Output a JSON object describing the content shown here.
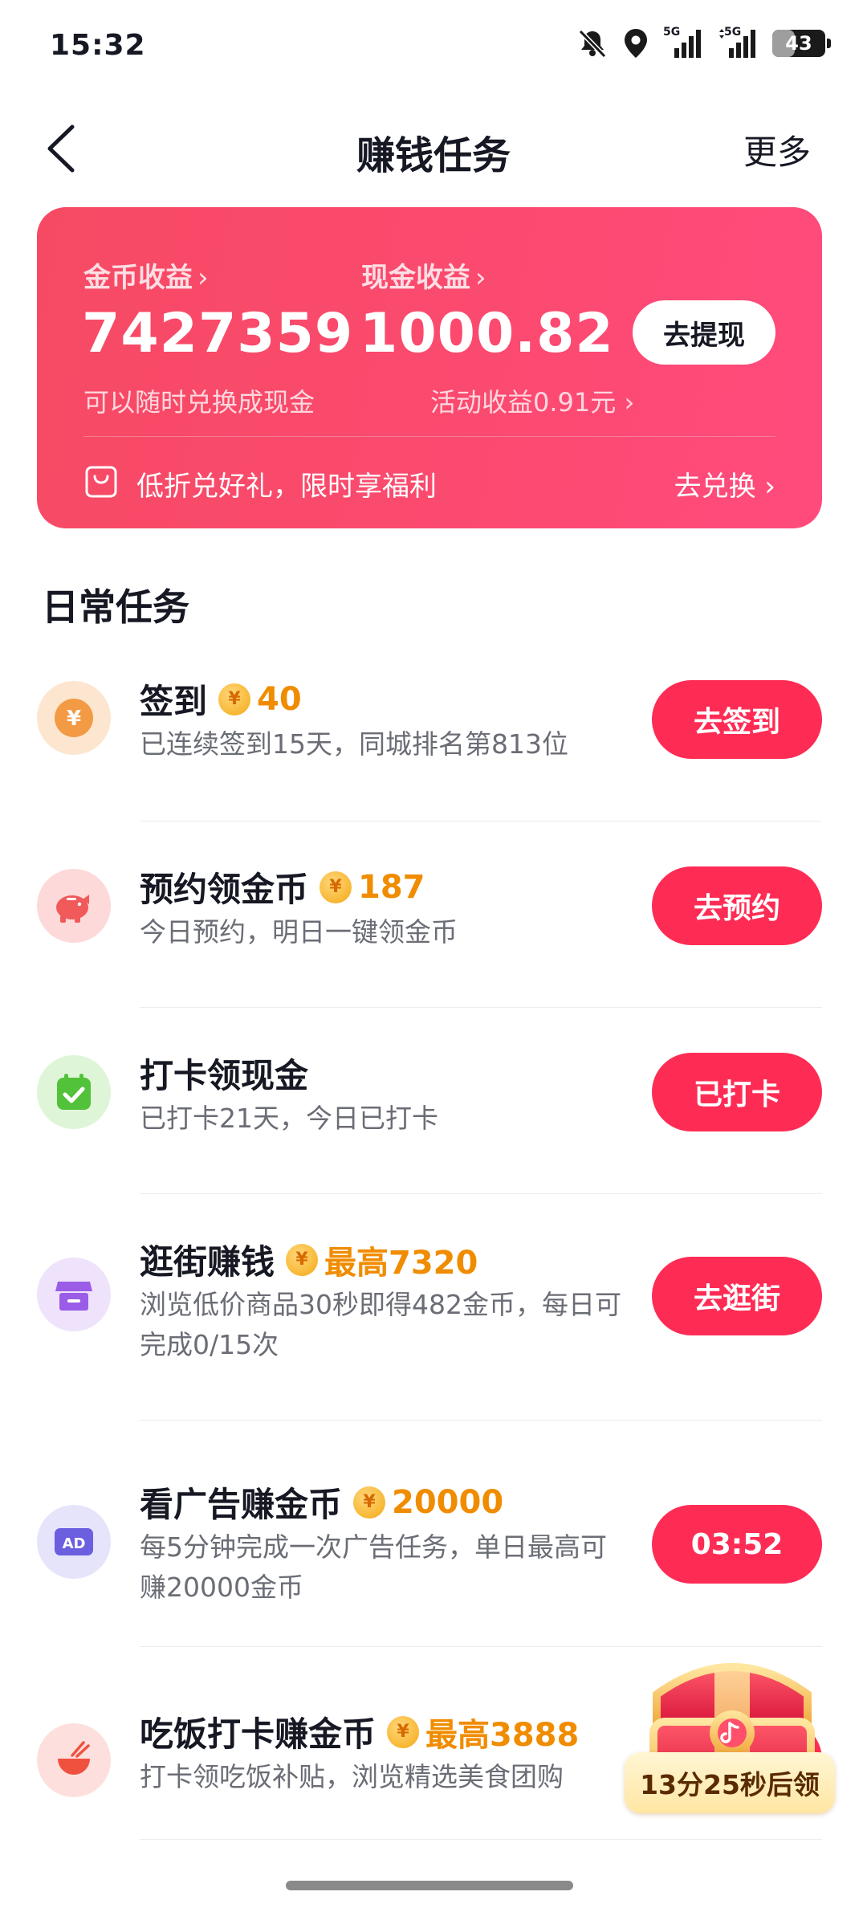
{
  "status_bar": {
    "time": "15:32",
    "signal1_label": "5G",
    "signal2_label": "5G",
    "battery": "43",
    "battery_level": 0.43
  },
  "header": {
    "title": "赚钱任务",
    "more": "更多"
  },
  "earnings": {
    "coin_label": "金币收益",
    "coin_value": "7427359",
    "coin_sub": "可以随时兑换成现金",
    "cash_label": "现金收益",
    "cash_value": "1000.82",
    "activity_sub": "活动收益0.91元",
    "withdraw_button": "去提现",
    "promo_text": "低折兑好礼，限时享福利",
    "promo_action": "去兑换"
  },
  "section_title": "日常任务",
  "tasks": [
    {
      "title": "签到",
      "reward": "40",
      "desc": "已连续签到15天，同城排名第813位",
      "button": "去签到",
      "icon": "yuan-coin-icon"
    },
    {
      "title": "预约领金币",
      "reward": "187",
      "desc": "今日预约，明日一键领金币",
      "button": "去预约",
      "icon": "piggy-bank-icon"
    },
    {
      "title": "打卡领现金",
      "reward": "",
      "desc": "已打卡21天，今日已打卡",
      "button": "已打卡",
      "icon": "calendar-check-icon"
    },
    {
      "title": "逛街赚钱",
      "reward": "最高7320",
      "desc": "浏览低价商品30秒即得482金币，每日可完成0/15次",
      "button": "去逛街",
      "icon": "store-icon"
    },
    {
      "title": "看广告赚金币",
      "reward": "20000",
      "desc": "每5分钟完成一次广告任务，单日最高可赚20000金币",
      "button": "03:52",
      "icon": "ad-icon"
    },
    {
      "title": "吃饭打卡赚金币",
      "reward": "最高3888",
      "desc": "打卡领吃饭补贴，浏览精选美食团购",
      "button": "",
      "icon": "rice-bowl-icon"
    }
  ],
  "chest": {
    "timer": "13分25秒后领"
  },
  "colors": {
    "primary_button": "#fe2c55",
    "card_gradient_start": "#f64a64",
    "card_gradient_end": "#ff4b7d",
    "reward_orange": "#f08c00"
  }
}
